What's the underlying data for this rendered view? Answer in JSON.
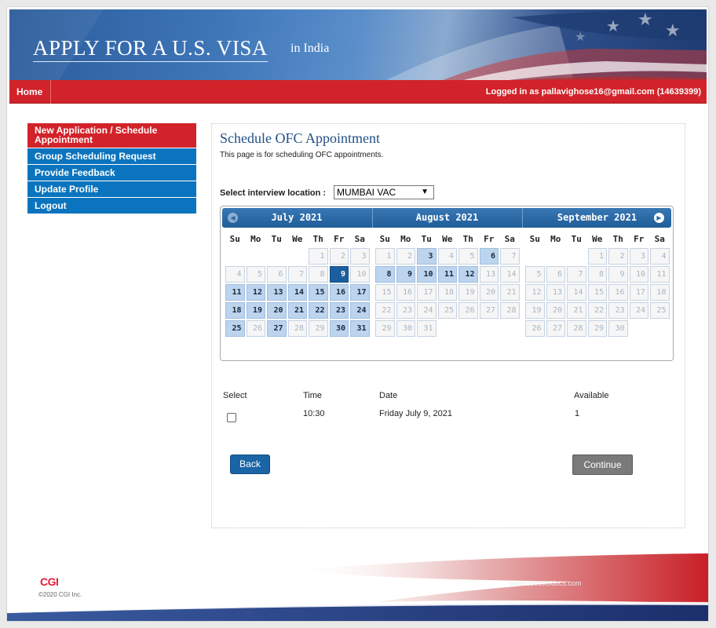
{
  "banner": {
    "title": "APPLY FOR A U.S. VISA",
    "subtitle": "in India"
  },
  "nav": {
    "home": "Home",
    "login": "Logged in as  pallavighose16@gmail.com (14639399)"
  },
  "sidebar": {
    "items": [
      {
        "label": "New Application / Schedule Appointment"
      },
      {
        "label": "Group Scheduling Request"
      },
      {
        "label": "Provide Feedback"
      },
      {
        "label": "Update Profile"
      },
      {
        "label": "Logout"
      }
    ]
  },
  "main": {
    "title": "Schedule OFC Appointment",
    "description": "This page is for scheduling OFC appointments.",
    "location_label": "Select interview location :",
    "location_value": "MUMBAI VAC"
  },
  "calendar": {
    "weekdays": [
      "Su",
      "Mo",
      "Tu",
      "We",
      "Th",
      "Fr",
      "Sa"
    ],
    "months": [
      {
        "name": "July 2021",
        "first_weekday": 4,
        "days": 31,
        "available": [
          9,
          11,
          12,
          13,
          14,
          15,
          16,
          17,
          18,
          19,
          20,
          21,
          22,
          23,
          24,
          25,
          27,
          30,
          31
        ],
        "selected": 9
      },
      {
        "name": "August 2021",
        "first_weekday": 0,
        "days": 31,
        "available": [
          3,
          6,
          8,
          9,
          10,
          11,
          12
        ],
        "selected": null
      },
      {
        "name": "September 2021",
        "first_weekday": 3,
        "days": 30,
        "available": [],
        "selected": null
      }
    ],
    "prev_icon": "chevron-left-circle-icon",
    "next_icon": "chevron-right-circle-icon"
  },
  "slots": {
    "headers": {
      "select": "Select",
      "time": "Time",
      "date": "Date",
      "available": "Available"
    },
    "rows": [
      {
        "time": "10:30",
        "date": "Friday July 9, 2021",
        "available": "1",
        "checked": false
      }
    ]
  },
  "buttons": {
    "back": "Back",
    "continue": "Continue"
  },
  "footer": {
    "logo": "CGI",
    "copyright": "©2020 CGI Inc.",
    "url": "www.ustraveldocs.com"
  },
  "colors": {
    "nav_red": "#d2232a",
    "sidebar_blue": "#0b74be",
    "title_blue": "#1f4f86",
    "selected_day": "#1c5f9e",
    "available_day": "#bcd4ee"
  }
}
